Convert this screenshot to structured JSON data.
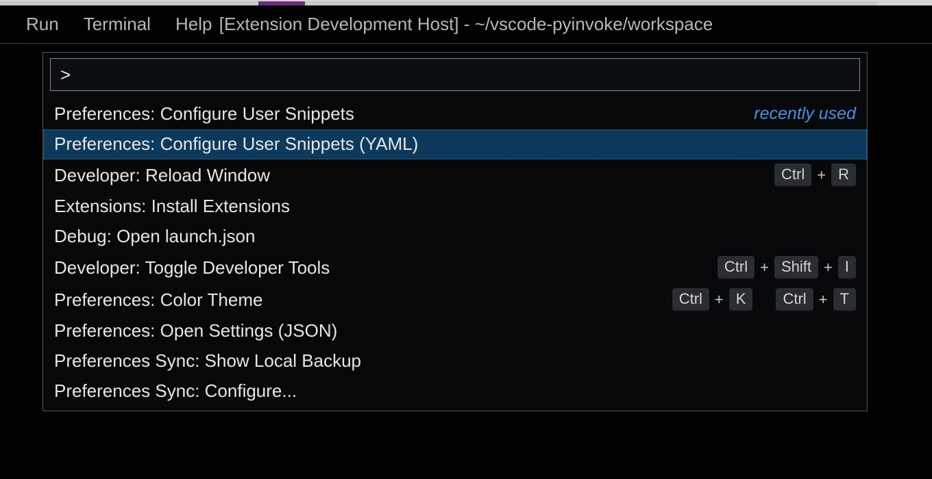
{
  "menubar": {
    "items": [
      "Run",
      "Terminal",
      "Help"
    ]
  },
  "window": {
    "title": "[Extension Development Host] - ~/vscode-pyinvoke/workspace"
  },
  "palette": {
    "input_value": ">",
    "recently_used_label": "recently used",
    "items": [
      {
        "label": "Preferences: Configure User Snippets",
        "recently_used": true,
        "selected": false,
        "keys": []
      },
      {
        "label": "Preferences: Configure User Snippets (YAML)",
        "recently_used": false,
        "selected": true,
        "keys": []
      },
      {
        "label": "Developer: Reload Window",
        "recently_used": false,
        "selected": false,
        "keys": [
          [
            "Ctrl",
            "R"
          ]
        ]
      },
      {
        "label": "Extensions: Install Extensions",
        "recently_used": false,
        "selected": false,
        "keys": []
      },
      {
        "label": "Debug: Open launch.json",
        "recently_used": false,
        "selected": false,
        "keys": []
      },
      {
        "label": "Developer: Toggle Developer Tools",
        "recently_used": false,
        "selected": false,
        "keys": [
          [
            "Ctrl",
            "Shift",
            "I"
          ]
        ]
      },
      {
        "label": "Preferences: Color Theme",
        "recently_used": false,
        "selected": false,
        "keys": [
          [
            "Ctrl",
            "K"
          ],
          [
            "Ctrl",
            "T"
          ]
        ]
      },
      {
        "label": "Preferences: Open Settings (JSON)",
        "recently_used": false,
        "selected": false,
        "keys": []
      },
      {
        "label": "Preferences Sync: Show Local Backup",
        "recently_used": false,
        "selected": false,
        "keys": []
      },
      {
        "label": "Preferences Sync: Configure...",
        "recently_used": false,
        "selected": false,
        "keys": []
      }
    ]
  }
}
